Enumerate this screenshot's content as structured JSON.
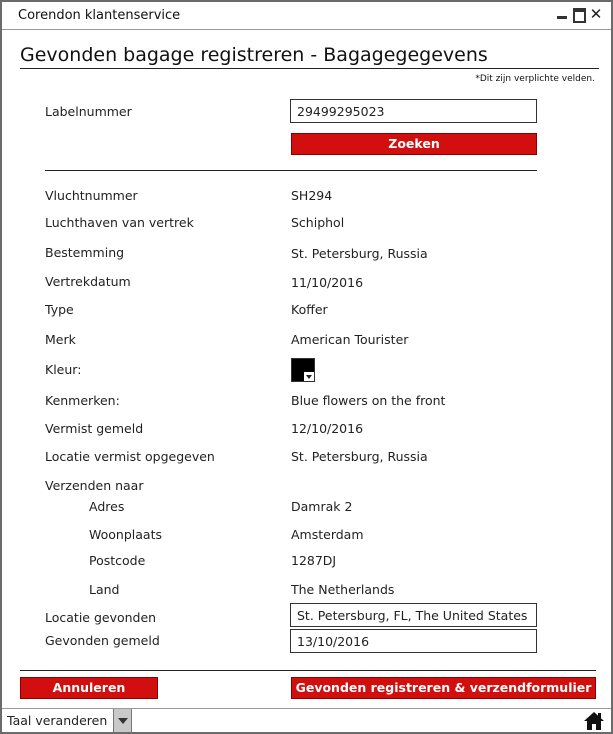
{
  "window": {
    "title": "Corendon klantenservice"
  },
  "page": {
    "title": "Gevonden bagage registreren - Bagagegegevens",
    "required_note": "*Dit zijn verplichte velden."
  },
  "search": {
    "label": "Labelnummer",
    "value": "29499295023",
    "button": "Zoeken"
  },
  "details": {
    "flight_label": "Vluchtnummer",
    "flight_value": "SH294",
    "departure_airport_label": "Luchthaven van vertrek",
    "departure_airport_value": "Schiphol",
    "destination_label": "Bestemming",
    "destination_value": "St. Petersburg, Russia",
    "departure_date_label": "Vertrekdatum",
    "departure_date_value": "11/10/2016",
    "type_label": "Type",
    "type_value": "Koffer",
    "brand_label": "Merk",
    "brand_value": "American Tourister",
    "color_label": "Kleur:",
    "color_value": "#000000",
    "features_label": "Kenmerken:",
    "features_value": "Blue flowers on the front",
    "reported_missing_label": "Vermist gemeld",
    "reported_missing_value": "12/10/2016",
    "missing_location_label": "Locatie vermist opgegeven",
    "missing_location_value": "St. Petersburg, Russia",
    "ship_to_label": "Verzenden naar",
    "address_label": "Adres",
    "address_value": "Damrak 2",
    "city_label": "Woonplaats",
    "city_value": "Amsterdam",
    "postcode_label": "Postcode",
    "postcode_value": "1287DJ",
    "country_label": "Land",
    "country_value": "The Netherlands"
  },
  "found": {
    "location_label": "Locatie gevonden",
    "location_value": "St. Petersburg, FL, The United States",
    "reported_label": "Gevonden gemeld",
    "reported_value": "13/10/2016"
  },
  "actions": {
    "cancel": "Annuleren",
    "submit": "Gevonden registreren & verzendformulier printen"
  },
  "footer": {
    "language": "Taal veranderen"
  },
  "colors": {
    "accent": "#d20f0f"
  }
}
